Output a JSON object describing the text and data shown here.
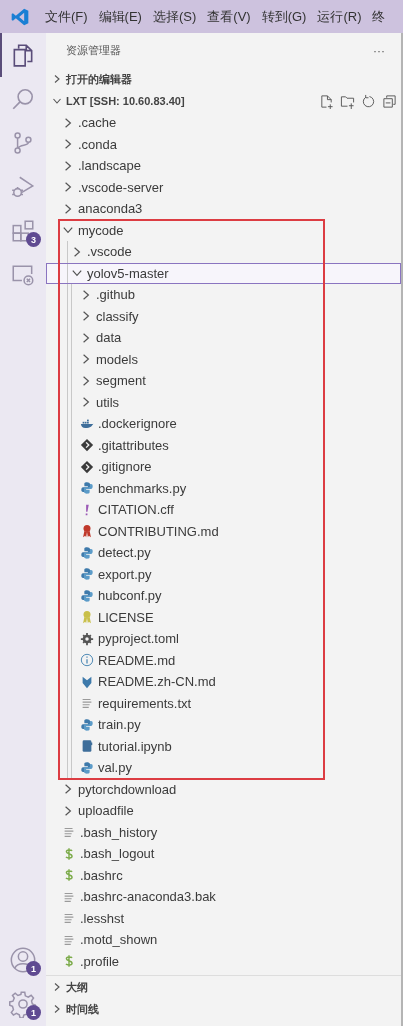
{
  "menu": [
    "文件(F)",
    "编辑(E)",
    "选择(S)",
    "查看(V)",
    "转到(G)",
    "运行(R)",
    "终"
  ],
  "activity_bar": {
    "top": [
      {
        "kind": "explorer",
        "selected": true
      },
      {
        "kind": "search",
        "selected": false
      },
      {
        "kind": "source-control",
        "selected": false
      },
      {
        "kind": "run-debug",
        "selected": false
      },
      {
        "kind": "extensions",
        "selected": false,
        "badge": "3"
      },
      {
        "kind": "remote",
        "selected": false
      }
    ],
    "bottom": [
      {
        "kind": "account",
        "selected": false,
        "badge": "1"
      },
      {
        "kind": "settings",
        "selected": false,
        "badge": "1"
      }
    ]
  },
  "explorer": {
    "title": "资源管理器",
    "more": "···",
    "sections": [
      {
        "title": "打开的编辑器",
        "expanded": false
      }
    ],
    "workspace": {
      "title": "LXT [SSH: 10.60.83.40]",
      "expanded": true,
      "items": [
        {
          "name": ".cache",
          "kind": "folder",
          "expanded": false,
          "selected": false
        },
        {
          "name": ".conda",
          "kind": "folder",
          "expanded": false,
          "selected": false
        },
        {
          "name": ".landscape",
          "kind": "folder",
          "expanded": false,
          "selected": false
        },
        {
          "name": ".vscode-server",
          "kind": "folder",
          "expanded": false,
          "selected": false
        },
        {
          "name": "anaconda3",
          "kind": "folder",
          "expanded": false,
          "selected": false
        },
        {
          "name": "mycode",
          "kind": "folder",
          "expanded": true,
          "selected": false,
          "annotated": true,
          "children": [
            {
              "name": ".vscode",
              "kind": "folder",
              "expanded": false,
              "selected": false
            },
            {
              "name": "yolov5-master",
              "kind": "folder",
              "expanded": true,
              "selected": true,
              "children": [
                {
                  "name": ".github",
                  "kind": "folder",
                  "expanded": false,
                  "selected": false
                },
                {
                  "name": "classify",
                  "kind": "folder",
                  "expanded": false,
                  "selected": false
                },
                {
                  "name": "data",
                  "kind": "folder",
                  "expanded": false,
                  "selected": false
                },
                {
                  "name": "models",
                  "kind": "folder",
                  "expanded": false,
                  "selected": false
                },
                {
                  "name": "segment",
                  "kind": "folder",
                  "expanded": false,
                  "selected": false
                },
                {
                  "name": "utils",
                  "kind": "folder",
                  "expanded": false,
                  "selected": false
                },
                {
                  "name": ".dockerignore",
                  "kind": "docker",
                  "selected": false
                },
                {
                  "name": ".gitattributes",
                  "kind": "git",
                  "selected": false
                },
                {
                  "name": ".gitignore",
                  "kind": "git",
                  "selected": false
                },
                {
                  "name": "benchmarks.py",
                  "kind": "python",
                  "selected": false
                },
                {
                  "name": "CITATION.cff",
                  "kind": "exclamation",
                  "selected": false
                },
                {
                  "name": "CONTRIBUTING.md",
                  "kind": "ribbon-red",
                  "selected": false
                },
                {
                  "name": "detect.py",
                  "kind": "python",
                  "selected": false
                },
                {
                  "name": "export.py",
                  "kind": "python",
                  "selected": false
                },
                {
                  "name": "hubconf.py",
                  "kind": "python",
                  "selected": false
                },
                {
                  "name": "LICENSE",
                  "kind": "ribbon-yellow",
                  "selected": false
                },
                {
                  "name": "pyproject.toml",
                  "kind": "gear",
                  "selected": false
                },
                {
                  "name": "README.md",
                  "kind": "info",
                  "selected": false
                },
                {
                  "name": "README.zh-CN.md",
                  "kind": "markdown",
                  "selected": false
                },
                {
                  "name": "requirements.txt",
                  "kind": "text",
                  "selected": false
                },
                {
                  "name": "train.py",
                  "kind": "python",
                  "selected": false
                },
                {
                  "name": "tutorial.ipynb",
                  "kind": "notebook",
                  "selected": false
                },
                {
                  "name": "val.py",
                  "kind": "python",
                  "selected": false
                }
              ]
            }
          ]
        },
        {
          "name": "pytorchdownload",
          "kind": "folder",
          "expanded": false,
          "selected": false
        },
        {
          "name": "uploadfile",
          "kind": "folder",
          "expanded": false,
          "selected": false
        },
        {
          "name": ".bash_history",
          "kind": "text",
          "selected": false
        },
        {
          "name": ".bash_logout",
          "kind": "shell",
          "selected": false
        },
        {
          "name": ".bashrc",
          "kind": "shell",
          "selected": false
        },
        {
          "name": ".bashrc-anaconda3.bak",
          "kind": "text",
          "selected": false
        },
        {
          "name": ".lesshst",
          "kind": "text",
          "selected": false
        },
        {
          "name": ".motd_shown",
          "kind": "text",
          "selected": false
        },
        {
          "name": ".profile",
          "kind": "shell",
          "selected": false
        }
      ]
    },
    "bottom_sections": [
      {
        "title": "大纲",
        "expanded": false
      },
      {
        "title": "时间线",
        "expanded": false
      }
    ]
  }
}
